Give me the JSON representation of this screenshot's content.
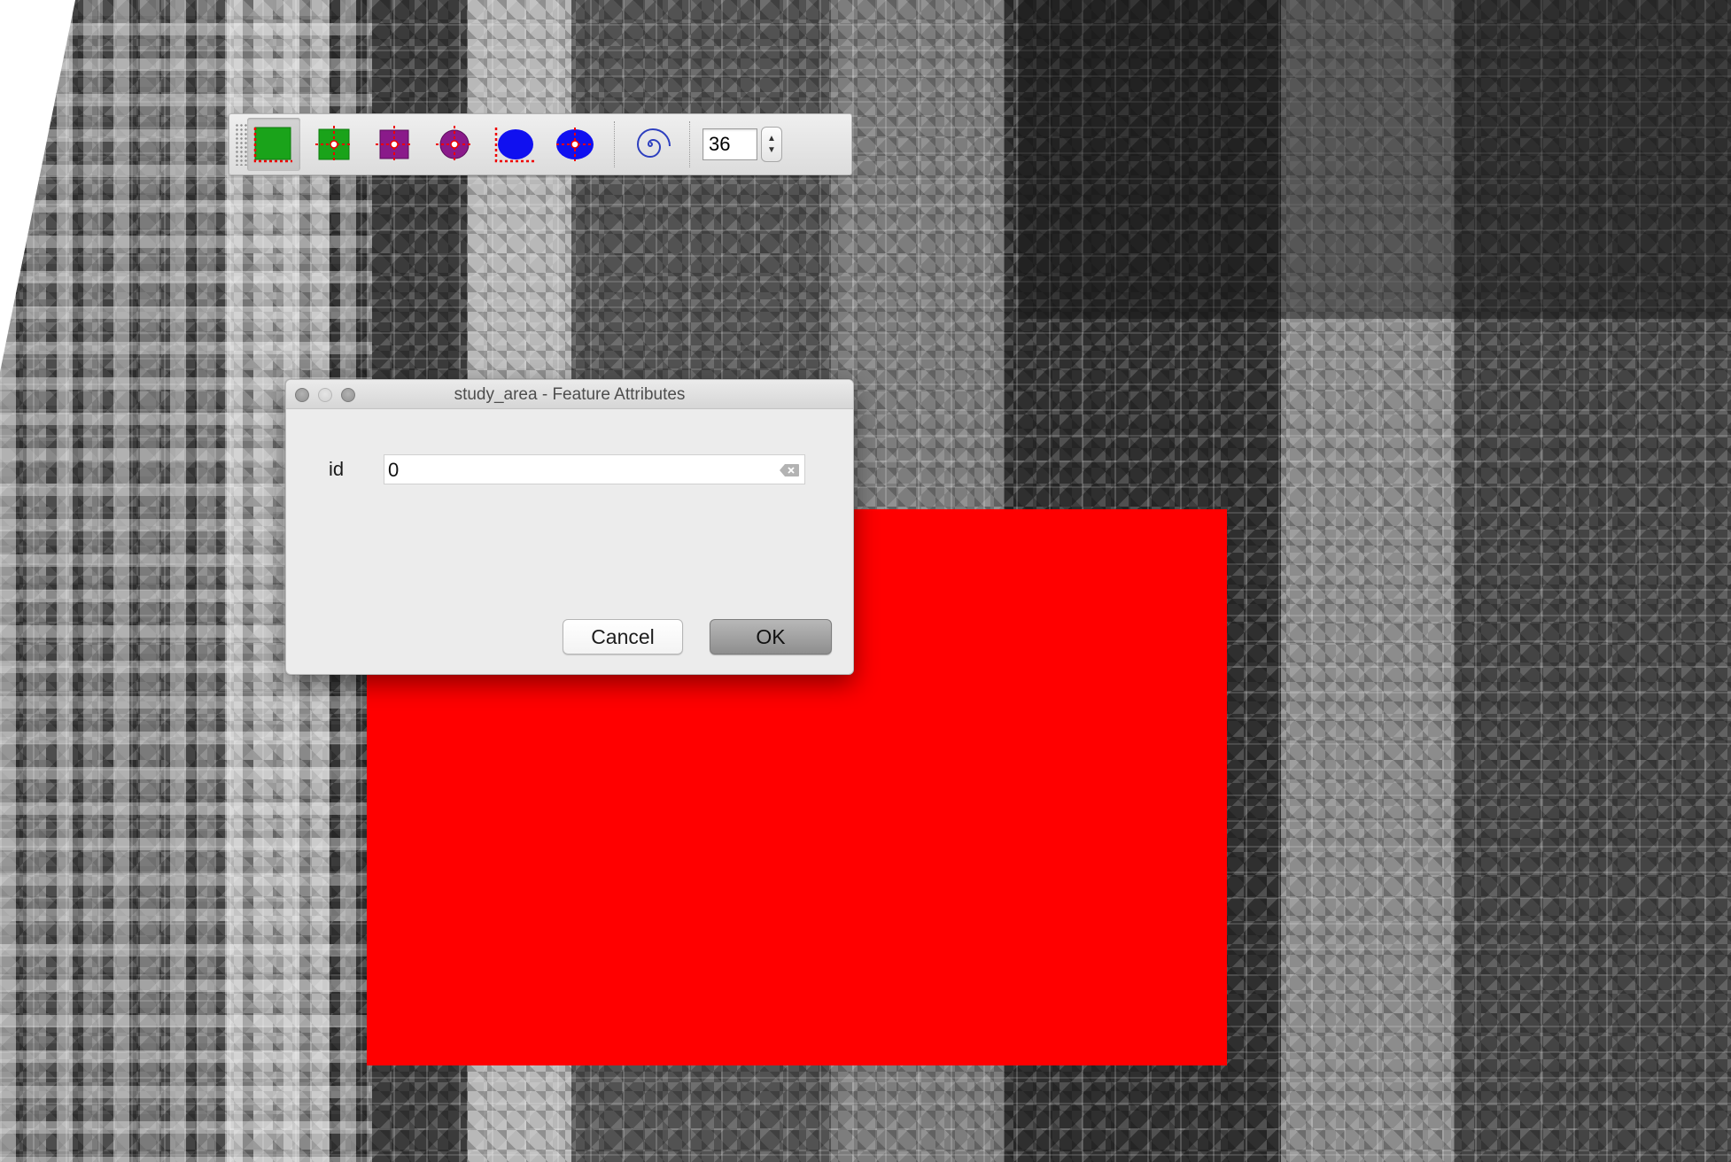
{
  "map": {
    "polygon_fill_color": "#ff0000"
  },
  "toolbar": {
    "tools": [
      {
        "name": "add-rectangle-from-extent-tool",
        "active": true
      },
      {
        "name": "add-rectangle-from-center-tool",
        "active": false
      },
      {
        "name": "add-square-from-center-tool",
        "active": false
      },
      {
        "name": "add-circle-from-center-tool",
        "active": false
      },
      {
        "name": "add-ellipse-from-extent-tool",
        "active": false
      },
      {
        "name": "add-ellipse-from-center-tool",
        "active": false
      },
      {
        "name": "add-spiral-tool",
        "active": false
      }
    ],
    "segments_value": "36"
  },
  "dialog": {
    "title": "study_area - Feature Attributes",
    "field_label": "id",
    "field_value": "0",
    "cancel_label": "Cancel",
    "ok_label": "OK"
  }
}
